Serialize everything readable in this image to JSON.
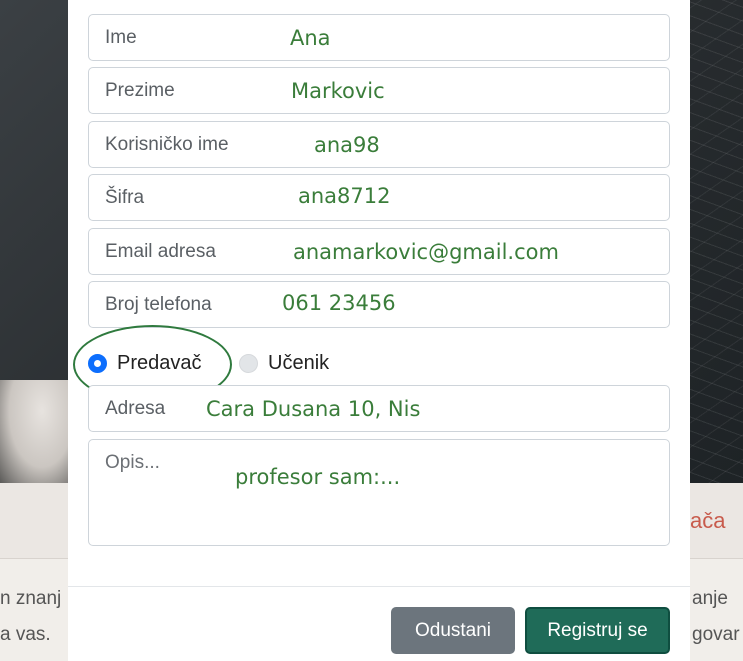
{
  "background": {
    "side_link": "ača",
    "left_line_1": "n znanj",
    "left_line_2": "a vas.",
    "right_line_1": "anje",
    "right_line_2": "govar"
  },
  "form": {
    "first_name": {
      "label": "Ime",
      "value": "Ana"
    },
    "last_name": {
      "label": "Prezime",
      "value": "Markovic"
    },
    "username": {
      "label": "Korisničko ime",
      "value": "ana98"
    },
    "password": {
      "label": "Šifra",
      "value": "ana8712"
    },
    "email": {
      "label": "Email adresa",
      "value": "anamarkovic@gmail.com"
    },
    "phone": {
      "label": "Broj telefona",
      "value": "061 23456"
    },
    "role": {
      "options": [
        {
          "label": "Predavač",
          "selected": true
        },
        {
          "label": "Učenik",
          "selected": false
        }
      ]
    },
    "address": {
      "label": "Adresa",
      "value": "Cara Dusana 10, Nis"
    },
    "description": {
      "placeholder": "Opis...",
      "value": "profesor sam:..."
    }
  },
  "buttons": {
    "cancel": "Odustani",
    "submit": "Registruj se"
  },
  "colors": {
    "annotation_green": "#3a7d3a",
    "primary_radio": "#0d6efd",
    "submit_button": "#1f6b58",
    "cancel_button": "#6c757d"
  }
}
